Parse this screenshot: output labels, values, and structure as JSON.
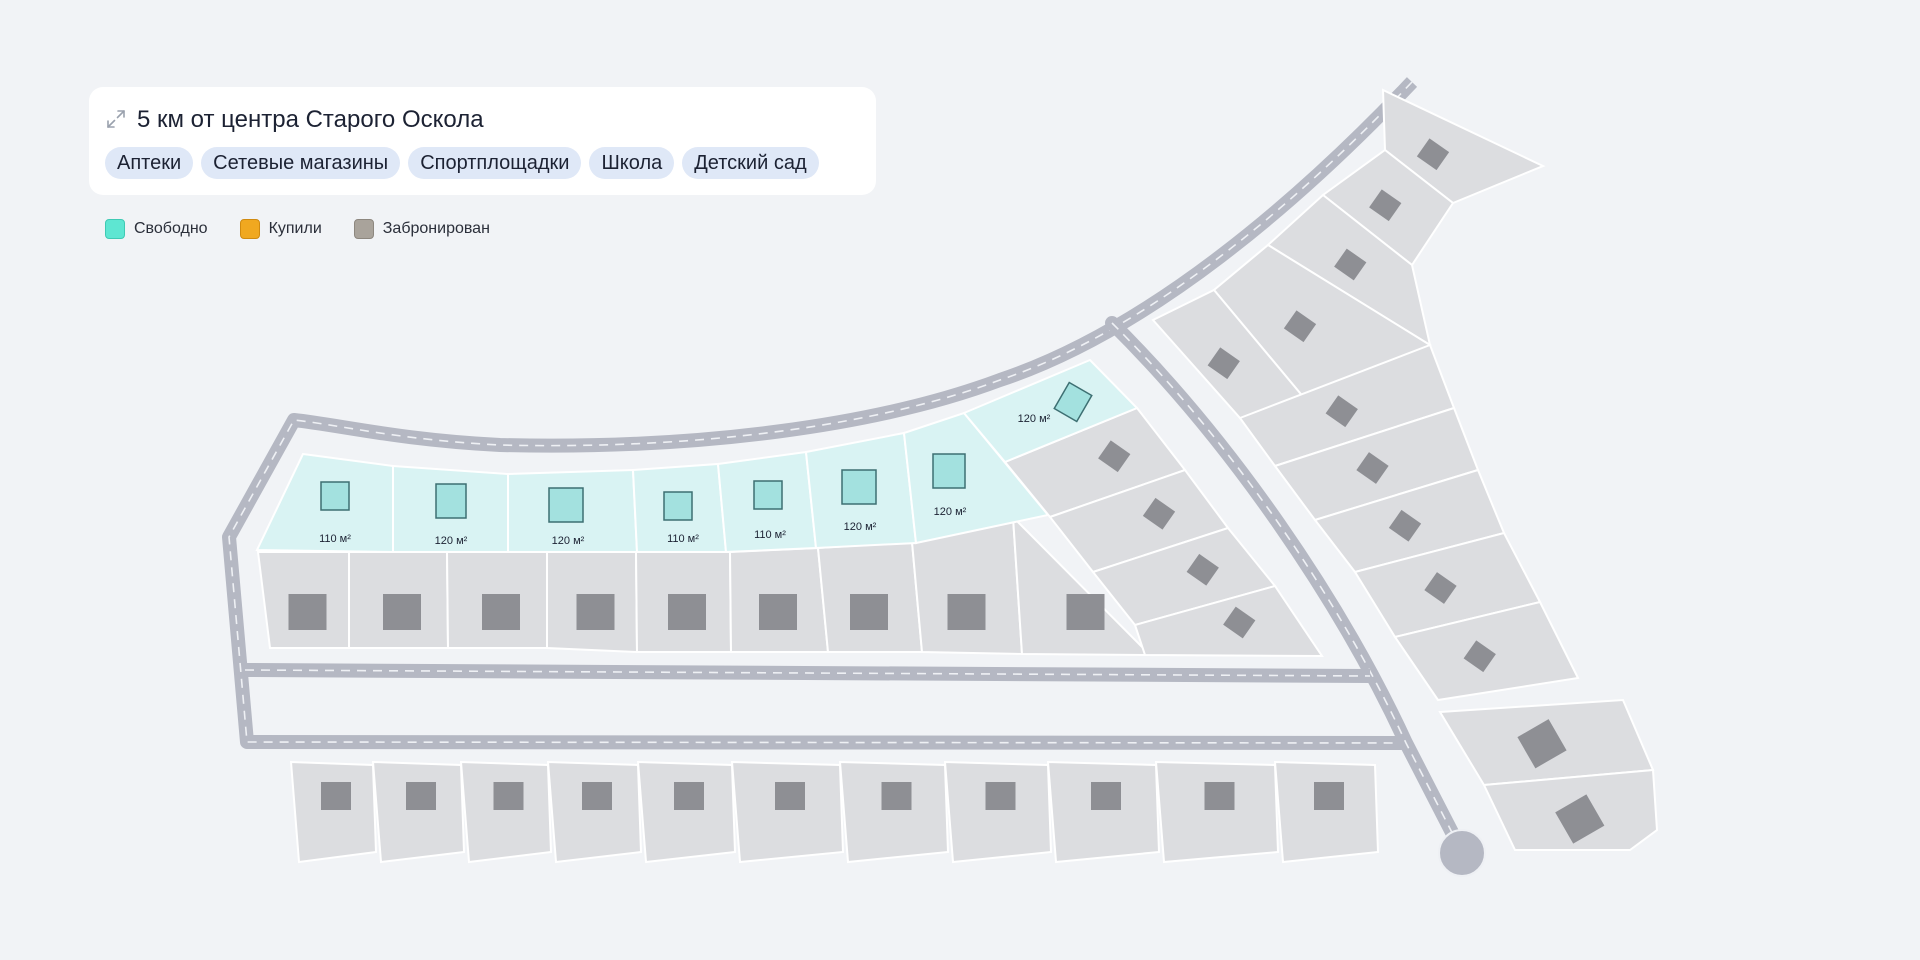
{
  "info": {
    "title": "5 км от центра Старого Оскола",
    "tags": [
      "Аптеки",
      "Сетевые магазины",
      "Спортплощадки",
      "Школа",
      "Детский сад"
    ]
  },
  "legend": [
    {
      "label": "Свободно",
      "color": "#5ee6d2",
      "border": "#3fcab4"
    },
    {
      "label": "Купили",
      "color": "#f0a820",
      "border": "#d08a10"
    },
    {
      "label": "Забронирован",
      "color": "#a9a39b",
      "border": "#8d877f"
    }
  ],
  "colors": {
    "plot_free": "#d9f3f3",
    "plot_default": "#dcdde0",
    "house_free": "#a3e1df",
    "house_outline_free": "#3d6f72",
    "house_default": "#8e8f94",
    "road": "#b5b8c3",
    "road_dash": "#eef0f4"
  },
  "plots": {
    "available": [
      {
        "area_label": "110 м²",
        "status": "free"
      },
      {
        "area_label": "120 м²",
        "status": "free"
      },
      {
        "area_label": "120 м²",
        "status": "free"
      },
      {
        "area_label": "110 м²",
        "status": "free"
      },
      {
        "area_label": "110 м²",
        "status": "free"
      },
      {
        "area_label": "120 м²",
        "status": "free"
      },
      {
        "area_label": "120 м²",
        "status": "free"
      },
      {
        "area_label": "120 м²",
        "status": "free"
      }
    ]
  }
}
